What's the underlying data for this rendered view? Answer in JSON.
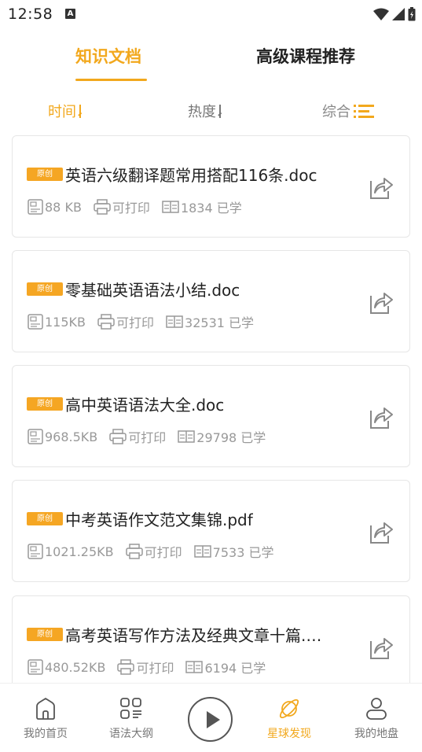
{
  "status": {
    "time": "12:58",
    "notif_letter": "A"
  },
  "tabs": [
    {
      "label": "知识文档",
      "active": true
    },
    {
      "label": "高级课程推荐",
      "active": false
    }
  ],
  "sort": [
    {
      "label": "时间",
      "icon": "arrow-down-icon",
      "active": true
    },
    {
      "label": "热度",
      "icon": "arrow-down-icon",
      "active": false
    },
    {
      "label": "综合",
      "icon": "list-icon",
      "active": false
    }
  ],
  "badge_label": "原创",
  "print_label": "可打印",
  "documents": [
    {
      "title": "英语六级翻译题常用搭配116条.doc",
      "size": "88 KB",
      "learners": "1834 已学"
    },
    {
      "title": "零基础英语语法小结.doc",
      "size": "115KB",
      "learners": "32531 已学"
    },
    {
      "title": "高中英语语法大全.doc",
      "size": "968.5KB",
      "learners": "29798 已学"
    },
    {
      "title": "中考英语作文范文集锦.pdf",
      "size": "1021.25KB",
      "learners": "7533 已学"
    },
    {
      "title": "高考英语写作方法及经典文章十篇.…",
      "size": "480.52KB",
      "learners": "6194 已学"
    }
  ],
  "nav": [
    {
      "label": "我的首页",
      "icon": "home-icon",
      "active": false
    },
    {
      "label": "语法大纲",
      "icon": "grid-list-icon",
      "active": false
    },
    {
      "label": "",
      "icon": "play-icon",
      "active": false
    },
    {
      "label": "星球发现",
      "icon": "planet-icon",
      "active": true
    },
    {
      "label": "我的地盘",
      "icon": "user-icon",
      "active": false
    }
  ],
  "colors": {
    "accent": "#f2a81d",
    "badge": "#f5a623",
    "meta_text": "#999999",
    "card_border": "#e6e6e6"
  }
}
